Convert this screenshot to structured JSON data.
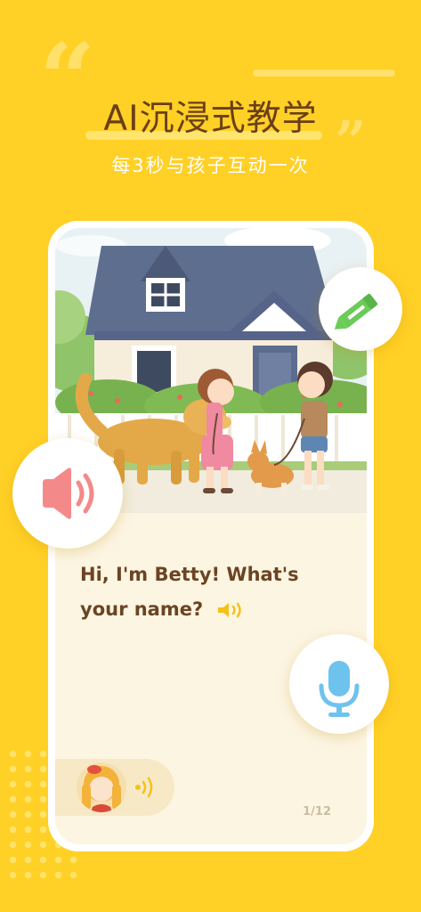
{
  "headline": "AI沉浸式教学",
  "subtitle": "每3秒与孩子互动一次",
  "dialog": {
    "text": "Hi, I'm Betty! What's your name?"
  },
  "pagination": "1/12",
  "icons": {
    "edit": "pencil-icon",
    "sound": "speaker-icon",
    "mic": "microphone-icon"
  },
  "colors": {
    "background": "#FFD026",
    "headline": "#6B3F18",
    "dialog_text": "#6B4423",
    "edit_icon": "#6BCB57",
    "sound_icon": "#F4898A",
    "mic_icon": "#6EC3EE"
  }
}
